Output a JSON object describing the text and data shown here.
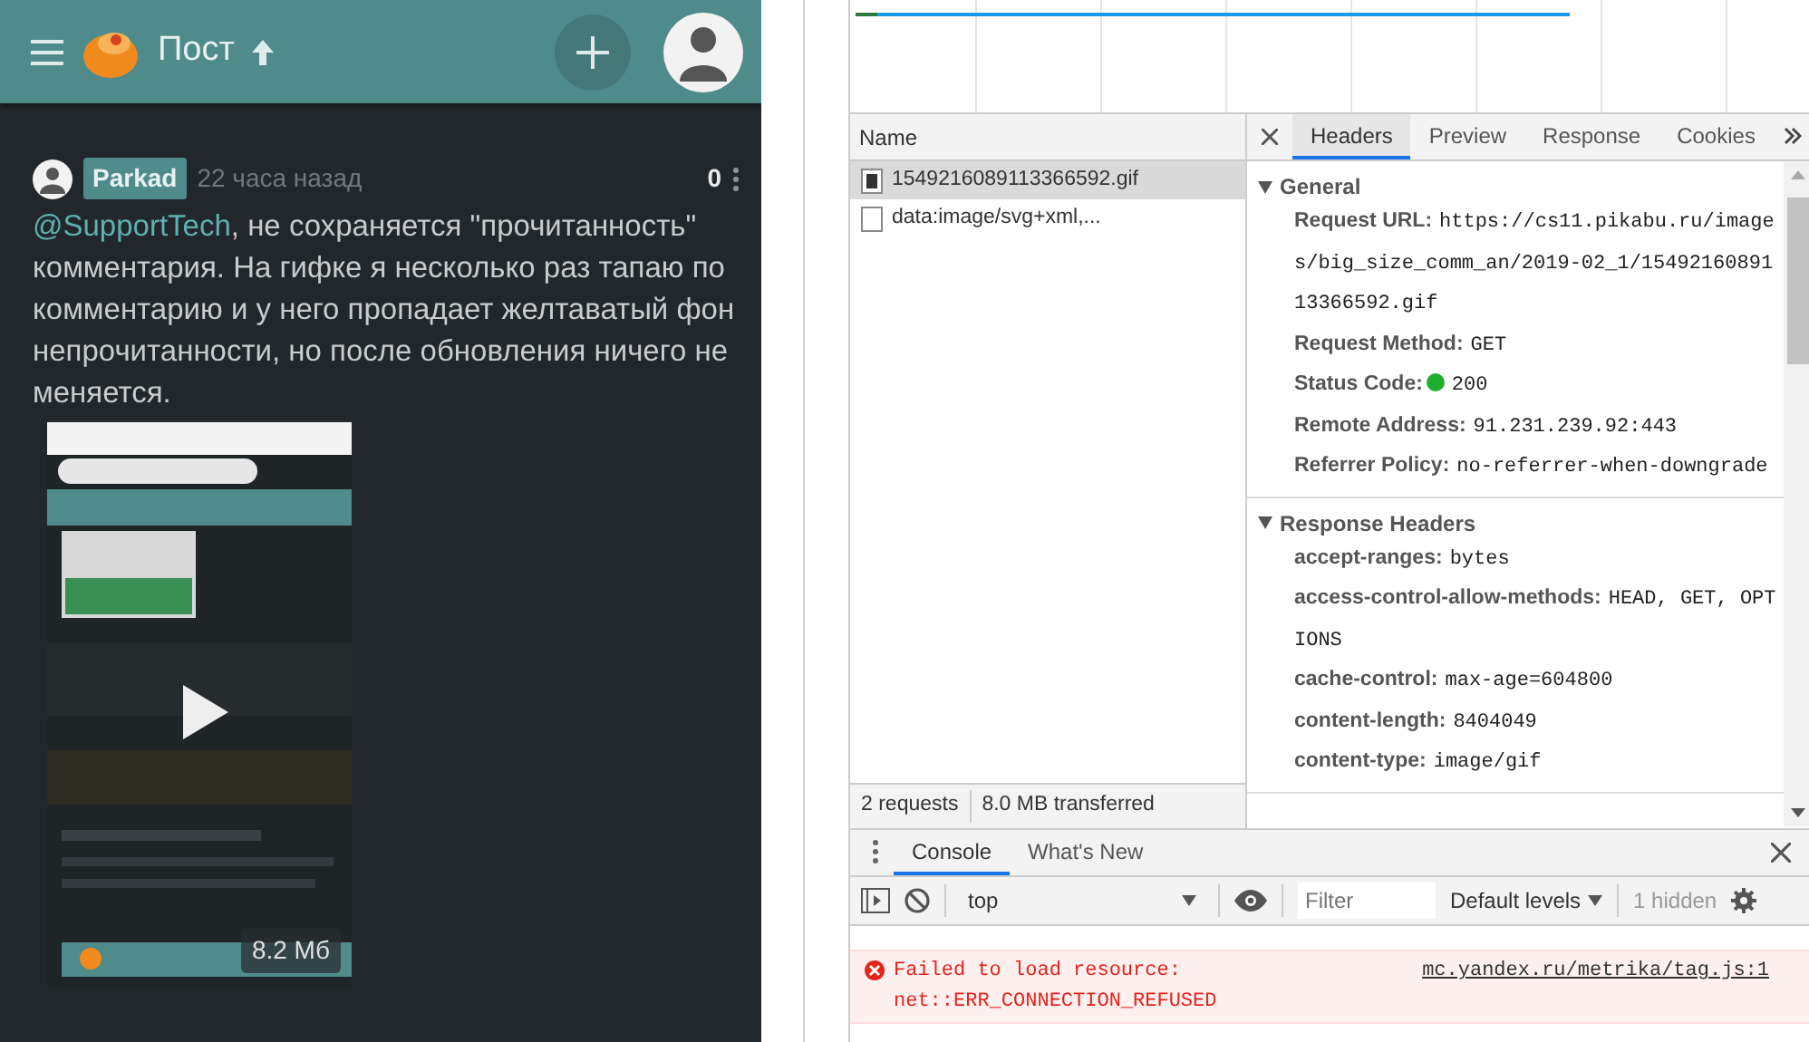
{
  "post_app": {
    "topbar": {
      "title": "Пост"
    },
    "comment": {
      "author": "Parkad",
      "time": "22 часа назад",
      "rating": "0",
      "mention": "@SupportTech",
      "text": ", не сохраняется \"прочитанность\" комментария. На гифке я несколько раз тапаю по комментарию и у него пропадает желтаватый фон непрочитанности, но после обновления ничего не меняется."
    },
    "media": {
      "kind": "picture",
      "size": "8.2 Мб"
    }
  },
  "devtools": {
    "requests": {
      "column": "Name",
      "rows": [
        {
          "name": "1549216089113366592.gif",
          "selected": true
        },
        {
          "name": "data:image/svg+xml,...",
          "selected": false
        }
      ],
      "summary": [
        "2 requests",
        "8.0 MB transferred"
      ]
    },
    "detail_tabs": [
      {
        "label": "Headers",
        "selected": true
      },
      {
        "label": "Preview",
        "selected": false
      },
      {
        "label": "Response",
        "selected": false
      },
      {
        "label": "Cookies",
        "selected": false
      }
    ],
    "sections": [
      {
        "title": "General",
        "expanded": true,
        "headers": [
          {
            "name": "Request URL:",
            "value": "https://cs11.pikabu.ru/images/big_size_comm_an/2019-02_1/1549216089113366592.gif"
          },
          {
            "name": "Request Method:",
            "value": "GET"
          },
          {
            "name": "Status Code:",
            "value": "200",
            "color": "#1fae2e"
          },
          {
            "name": "Remote Address:",
            "value": "91.231.239.92:443"
          },
          {
            "name": "Referrer Policy:",
            "value": "no-referrer-when-downgrade"
          }
        ]
      },
      {
        "title": "Response Headers",
        "expanded": true,
        "headers": [
          {
            "name": "accept-ranges:",
            "value": "bytes"
          },
          {
            "name": "access-control-allow-methods:",
            "value": "HEAD, GET, OPTIONS"
          },
          {
            "name": "cache-control:",
            "value": "max-age=604800"
          },
          {
            "name": "content-length:",
            "value": "8404049"
          },
          {
            "name": "content-type:",
            "value": "image/gif"
          }
        ]
      }
    ],
    "drawer_tabs": [
      {
        "label": "Console",
        "selected": true
      },
      {
        "label": "What's New",
        "selected": false
      }
    ],
    "console_toolbar": {
      "context": "top",
      "filter_placeholder": "Filter",
      "levels": "Default levels",
      "hidden": "1 hidden"
    },
    "messages": [
      {
        "kind": "error",
        "text": "Failed to load resource: net::ERR_CONNECTION_REFUSED",
        "source": "mc.yandex.ru/metrika/tag.js:1"
      }
    ]
  }
}
